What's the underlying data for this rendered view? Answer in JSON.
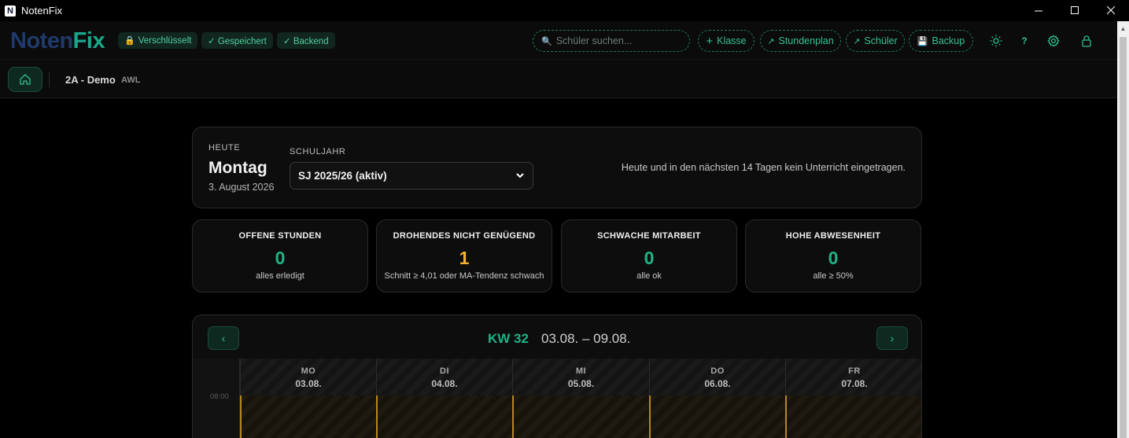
{
  "window": {
    "title": "NotenFix",
    "icon_letter": "N"
  },
  "header": {
    "logo_part1": "Noten",
    "logo_part2": "Fix",
    "chips": [
      {
        "icon": "lock-icon",
        "label": "Verschlüsselt"
      },
      {
        "icon": "check-icon",
        "label": "✓ Gespeichert"
      },
      {
        "icon": "check-icon",
        "label": "✓ Backend"
      }
    ],
    "search_placeholder": "Schüler suchen...",
    "buttons": {
      "klasse": "Klasse",
      "stundenplan": "Stundenplan",
      "schueler": "Schüler",
      "backup": "Backup"
    },
    "help_label": "?"
  },
  "subheader": {
    "class_name": "2A - Demo",
    "subject": "AWL"
  },
  "today": {
    "heute_label": "HEUTE",
    "day": "Montag",
    "date": "3. August 2026",
    "schuljahr_label": "SCHULJAHR",
    "schuljahr_value": "SJ 2025/26 (aktiv)",
    "info": "Heute und in den nächsten 14 Tagen kein Unterricht eingetragen."
  },
  "stats": [
    {
      "title": "OFFENE STUNDEN",
      "value": "0",
      "sub": "alles erledigt",
      "color": "#1fb385"
    },
    {
      "title": "DROHENDES NICHT GENÜGEND",
      "value": "1",
      "sub": "Schnitt ≥ 4,01 oder MA-Tendenz schwach",
      "color": "#f0b429"
    },
    {
      "title": "SCHWACHE MITARBEIT",
      "value": "0",
      "sub": "alle ok",
      "color": "#1fb385"
    },
    {
      "title": "HOHE ABWESENHEIT",
      "value": "0",
      "sub": "alle ≥ 50%",
      "color": "#1fb385"
    }
  ],
  "week": {
    "kw": "KW 32",
    "range": "03.08. – 09.08.",
    "time_first": "08:00",
    "days": [
      {
        "name": "MO",
        "date": "03.08."
      },
      {
        "name": "DI",
        "date": "04.08."
      },
      {
        "name": "MI",
        "date": "05.08."
      },
      {
        "name": "DO",
        "date": "06.08."
      },
      {
        "name": "FR",
        "date": "07.08."
      }
    ]
  },
  "colors": {
    "accent": "#1fb385",
    "warning": "#f0b429",
    "background": "#000000"
  }
}
